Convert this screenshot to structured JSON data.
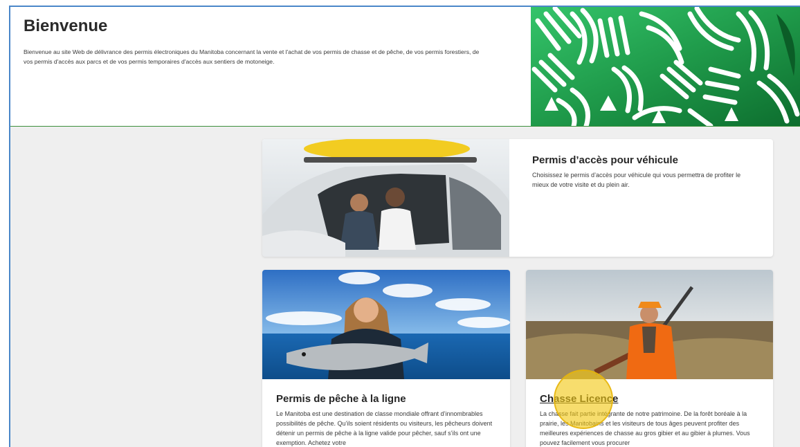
{
  "hero": {
    "title": "Bienvenue",
    "text": "Bienvenue au site Web de délivrance des permis électroniques du Manitoba concernant la vente et l'achat de vos permis de chasse et de pêche, de vos permis forestiers, de vos permis d'accès aux parcs et de vos permis temporaires d'accès aux sentiers de motoneige."
  },
  "cards": {
    "vehicle": {
      "title": "Permis d’accès pour véhicule",
      "text": "Choisissez le permis d’accès pour véhicule qui vous permettra de profiter le mieux de votre visite et du plein air."
    },
    "fishing": {
      "title": "Permis de pêche à la ligne",
      "text": "Le Manitoba est une destination de classe mondiale offrant d’innombrables possibilités de pêche. Qu’ils soient résidents ou visiteurs, les pêcheurs doivent détenir un permis de pêche à la ligne valide pour pêcher, sauf s’ils ont une exemption. Achetez votre"
    },
    "hunting": {
      "title": "Chasse Licence",
      "text": "La chasse fait partie intégrante de notre patrimoine. De la forêt boréale à la prairie, les Manitobains et les visiteurs de tous âges peuvent profiter des meilleures expériences de chasse au gros gibier et au gibier à plumes. Vous pouvez facilement vous procurer"
    }
  },
  "colors": {
    "frame_border": "#4a86c8",
    "hero_divider": "#3a8f3a",
    "pattern_green": "#1f9a4a",
    "cursor_highlight": "#f2c814"
  }
}
